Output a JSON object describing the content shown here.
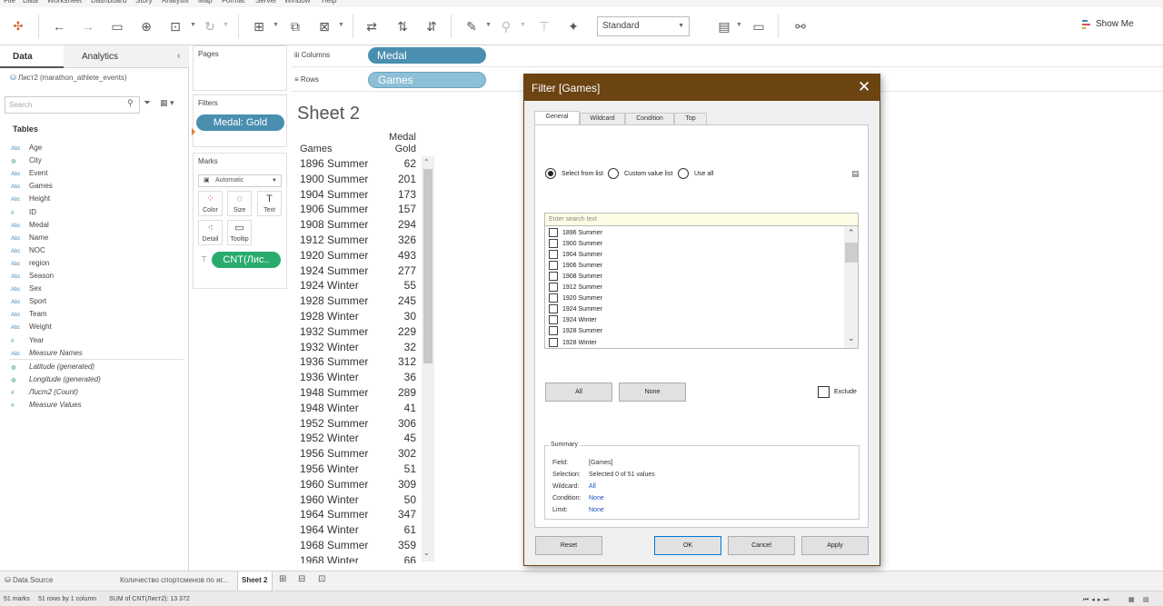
{
  "menu": [
    "File",
    "Data",
    "Worksheet",
    "Dashboard",
    "Story",
    "Analysis",
    "Map",
    "Format",
    "Server",
    "Window",
    "Help"
  ],
  "toolbar": {
    "view_mode": "Standard",
    "show_me": "Show Me"
  },
  "data_pane": {
    "tab_data": "Data",
    "tab_analytics": "Analytics",
    "datasource": "Лист2 (marathon_athlete_events)",
    "search_placeholder": "Search",
    "tables_title": "Tables",
    "fields": [
      {
        "type": "Abc",
        "name": "Age"
      },
      {
        "type": "globe",
        "name": "City"
      },
      {
        "type": "Abc",
        "name": "Event"
      },
      {
        "type": "Abc",
        "name": "Games"
      },
      {
        "type": "Abc",
        "name": "Height"
      },
      {
        "type": "#",
        "name": "ID"
      },
      {
        "type": "Abc",
        "name": "Medal"
      },
      {
        "type": "Abc",
        "name": "Name"
      },
      {
        "type": "Abc",
        "name": "NOC"
      },
      {
        "type": "Abc",
        "name": "region"
      },
      {
        "type": "Abc",
        "name": "Season"
      },
      {
        "type": "Abc",
        "name": "Sex"
      },
      {
        "type": "Abc",
        "name": "Sport"
      },
      {
        "type": "Abc",
        "name": "Team"
      },
      {
        "type": "Abc",
        "name": "Weight"
      },
      {
        "type": "#",
        "name": "Year"
      },
      {
        "type": "Abc",
        "name": "Measure Names"
      }
    ],
    "measures": [
      {
        "type": "globe",
        "name": "Latitude (generated)"
      },
      {
        "type": "globe",
        "name": "Longitude (generated)"
      },
      {
        "type": "#",
        "name": "Лист2 (Count)"
      },
      {
        "type": "#",
        "name": "Measure Values"
      }
    ]
  },
  "shelves": {
    "pages": "Pages",
    "filters": "Filters",
    "filter_pill": "Medal: Gold",
    "marks": "Marks",
    "marks_type": "Automatic",
    "mark_buttons": [
      "Color",
      "Size",
      "Text",
      "Detail",
      "Tooltip"
    ],
    "marks_pill": "CNT(Лис..",
    "columns_label": "Columns",
    "columns_pill": "Medal",
    "rows_label": "Rows",
    "rows_pill": "Games"
  },
  "sheet": {
    "title": "Sheet 2",
    "header_games": "Games",
    "header_medal": "Medal",
    "header_gold": "Gold",
    "rows": [
      {
        "games": "1896 Summer",
        "value": "62"
      },
      {
        "games": "1900 Summer",
        "value": "201"
      },
      {
        "games": "1904 Summer",
        "value": "173"
      },
      {
        "games": "1906 Summer",
        "value": "157"
      },
      {
        "games": "1908 Summer",
        "value": "294"
      },
      {
        "games": "1912 Summer",
        "value": "326"
      },
      {
        "games": "1920 Summer",
        "value": "493"
      },
      {
        "games": "1924 Summer",
        "value": "277"
      },
      {
        "games": "1924 Winter",
        "value": "55"
      },
      {
        "games": "1928 Summer",
        "value": "245"
      },
      {
        "games": "1928 Winter",
        "value": "30"
      },
      {
        "games": "1932 Summer",
        "value": "229"
      },
      {
        "games": "1932 Winter",
        "value": "32"
      },
      {
        "games": "1936 Summer",
        "value": "312"
      },
      {
        "games": "1936 Winter",
        "value": "36"
      },
      {
        "games": "1948 Summer",
        "value": "289"
      },
      {
        "games": "1948 Winter",
        "value": "41"
      },
      {
        "games": "1952 Summer",
        "value": "306"
      },
      {
        "games": "1952 Winter",
        "value": "45"
      },
      {
        "games": "1956 Summer",
        "value": "302"
      },
      {
        "games": "1956 Winter",
        "value": "51"
      },
      {
        "games": "1960 Summer",
        "value": "309"
      },
      {
        "games": "1960 Winter",
        "value": "50"
      },
      {
        "games": "1964 Summer",
        "value": "347"
      },
      {
        "games": "1964 Winter",
        "value": "61"
      },
      {
        "games": "1968 Summer",
        "value": "359"
      },
      {
        "games": "1968 Winter",
        "value": "66"
      }
    ]
  },
  "bottom_tabs": {
    "data_source": "Data Source",
    "sheet1": "Количество спортсменов по иг...",
    "sheet2": "Sheet 2"
  },
  "status": {
    "marks": "51 marks",
    "dims": "51 rows by 1 column",
    "sum": "SUM of CNT(Лист2): 13 372"
  },
  "dialog": {
    "title": "Filter [Games]",
    "tabs": [
      "General",
      "Wildcard",
      "Condition",
      "Top"
    ],
    "radio_select": "Select from list",
    "radio_custom": "Custom value list",
    "radio_all": "Use all",
    "search_placeholder": "Enter search text",
    "items": [
      "1896 Summer",
      "1900 Summer",
      "1904 Summer",
      "1906 Summer",
      "1908 Summer",
      "1912 Summer",
      "1920 Summer",
      "1924 Summer",
      "1924 Winter",
      "1928 Summer",
      "1928 Winter"
    ],
    "btn_all": "All",
    "btn_none": "None",
    "exclude": "Exclude",
    "summary": {
      "title": "Summary",
      "field_k": "Field:",
      "field_v": "[Games]",
      "selection_k": "Selection:",
      "selection_v": "Selected 0 of 51 values",
      "wildcard_k": "Wildcard:",
      "wildcard_v": "All",
      "condition_k": "Condition:",
      "condition_v": "None",
      "limit_k": "Limit:",
      "limit_v": "None"
    },
    "btn_reset": "Reset",
    "btn_ok": "OK",
    "btn_cancel": "Cancel",
    "btn_apply": "Apply"
  }
}
